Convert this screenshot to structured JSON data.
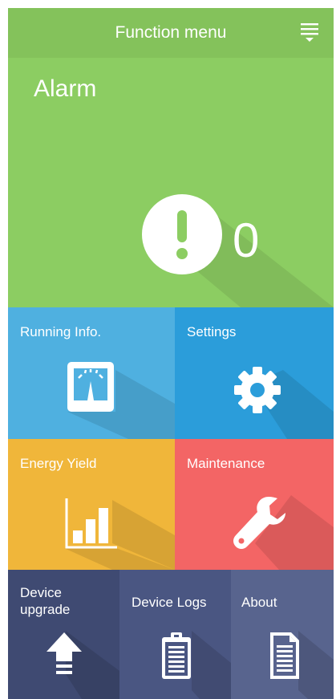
{
  "header": {
    "title": "Function menu"
  },
  "alarm": {
    "title": "Alarm",
    "count": "0"
  },
  "tiles": {
    "running_info": "Running Info.",
    "settings": "Settings",
    "energy_yield": "Energy Yield",
    "maintenance": "Maintenance",
    "device_upgrade_line1": "Device",
    "device_upgrade_line2": "upgrade",
    "device_logs": "Device Logs",
    "about": "About"
  },
  "colors": {
    "header": "#84c25b",
    "alarm": "#8ccd62",
    "running_info": "#4fb0e0",
    "settings": "#2b9dda",
    "energy_yield": "#f0b63a",
    "maintenance": "#f36565",
    "device_upgrade": "#3f4a72",
    "device_logs": "#4a5682",
    "about": "#58648e"
  },
  "icons": {
    "menu": "hamburger-menu-icon",
    "alarm": "exclamation-icon",
    "running_info": "meter-icon",
    "settings": "gear-icon",
    "energy_yield": "bar-chart-icon",
    "maintenance": "wrench-icon",
    "device_upgrade": "upload-arrow-icon",
    "device_logs": "clipboard-icon",
    "about": "document-icon"
  }
}
